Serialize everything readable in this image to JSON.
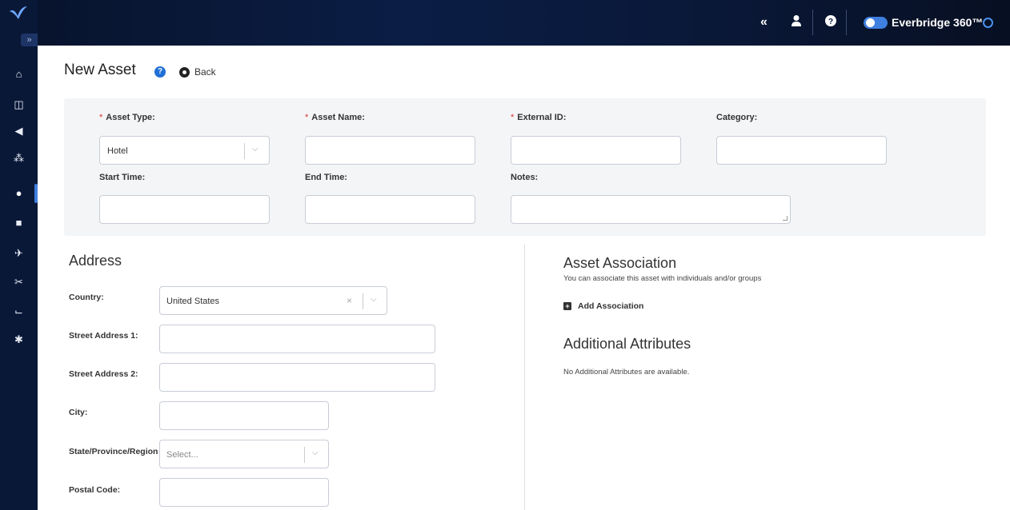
{
  "topbar": {
    "collapse_glyph": "«",
    "brand": "Everbridge 360™",
    "icons": [
      "user-icon",
      "help-icon",
      "toggle-switch",
      "brand-icon"
    ]
  },
  "sidebar": {
    "expand_glyph": "»",
    "items": [
      {
        "icon": "home-icon",
        "glyph": "⌂"
      },
      {
        "icon": "dashboard-icon",
        "glyph": "◫"
      },
      {
        "icon": "megaphone-icon",
        "glyph": "◀"
      },
      {
        "icon": "people-icon",
        "glyph": "⁂"
      },
      {
        "icon": "location-pin-icon",
        "glyph": "●"
      },
      {
        "icon": "briefcase-icon",
        "glyph": "■"
      },
      {
        "icon": "plane-icon",
        "glyph": "✈"
      },
      {
        "icon": "scissors-icon",
        "glyph": "✂"
      },
      {
        "icon": "chart-icon",
        "glyph": "⌙"
      },
      {
        "icon": "gear-icon",
        "glyph": "✱"
      }
    ]
  },
  "header": {
    "title": "New Asset",
    "help_glyph": "?",
    "back_label": "Back"
  },
  "form": {
    "asset_type": {
      "label": "Asset Type:",
      "value": "Hotel"
    },
    "asset_name": {
      "label": "Asset Name:",
      "value": ""
    },
    "external_id": {
      "label": "External ID:",
      "value": ""
    },
    "category": {
      "label": "Category:",
      "value": ""
    },
    "start_time": {
      "label": "Start Time:",
      "value": ""
    },
    "end_time": {
      "label": "End Time:",
      "value": ""
    },
    "notes": {
      "label": "Notes:",
      "value": ""
    },
    "required_marker": "*"
  },
  "address": {
    "title": "Address",
    "country": {
      "label": "Country:",
      "value": "United States"
    },
    "street1": {
      "label": "Street Address 1:"
    },
    "street2": {
      "label": "Street Address 2:"
    },
    "city": {
      "label": "City:"
    },
    "state": {
      "label": "State/Province/Region:",
      "placeholder": "Select..."
    },
    "postal": {
      "label": "Postal Code:"
    }
  },
  "association": {
    "title": "Asset Association",
    "subtitle": "You can associate this asset with individuals and/or groups",
    "add_label": "Add Association"
  },
  "attributes": {
    "title": "Additional Attributes",
    "empty_text": "No Additional Attributes are available."
  }
}
